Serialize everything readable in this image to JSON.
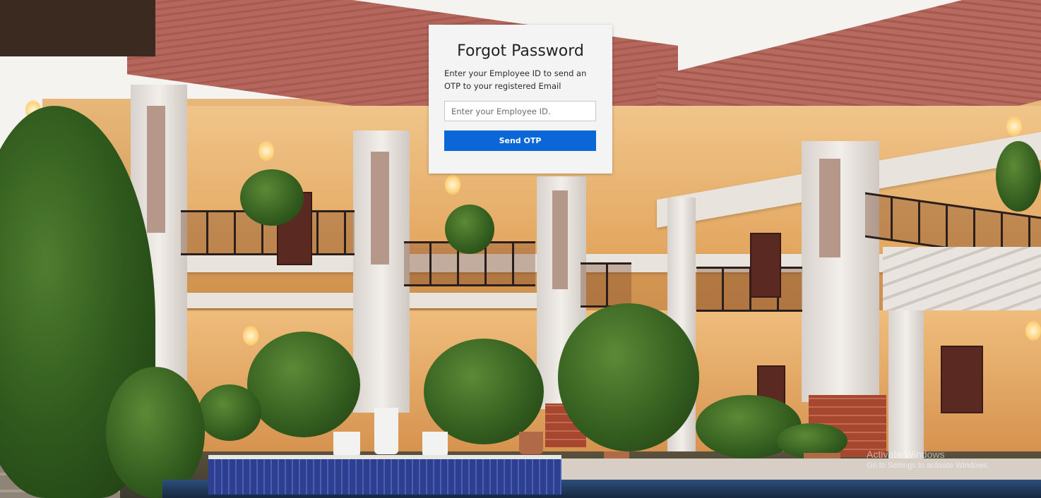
{
  "forgot_password": {
    "title": "Forgot Password",
    "description": "Enter your Employee ID to send an OTP to your registered Email",
    "employee_id_input": {
      "value": "",
      "placeholder": "Enter your Employee ID."
    },
    "send_button_label": "Send OTP"
  },
  "watermark": {
    "title": "Activate Windows",
    "subtitle": "Go to Settings to activate Windows."
  },
  "colors": {
    "primary_button": "#0b66d8",
    "card_background": "#f4f4f4"
  },
  "background": {
    "image": "hotel courtyard photo"
  }
}
